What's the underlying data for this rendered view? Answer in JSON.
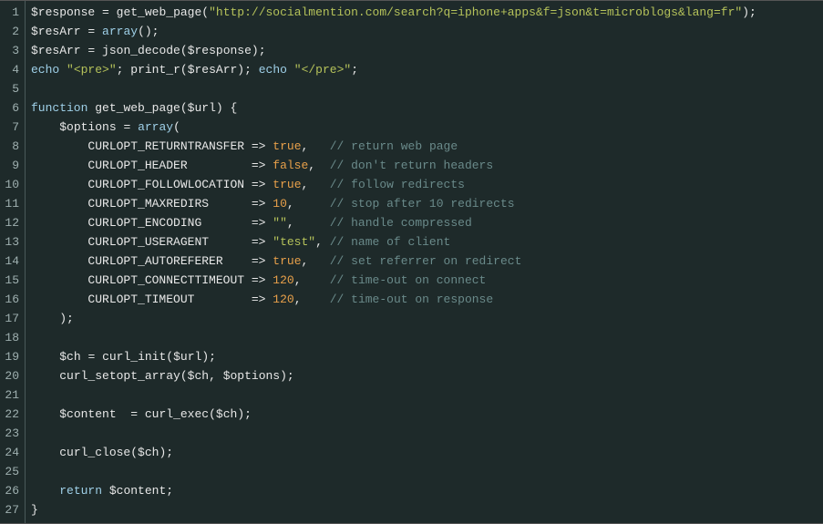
{
  "language": "php",
  "theme": "dark",
  "lines": [
    {
      "n": 1,
      "tokens": [
        {
          "t": "var",
          "v": "$response"
        },
        {
          "t": "plain",
          "v": " "
        },
        {
          "t": "op",
          "v": "="
        },
        {
          "t": "plain",
          "v": " "
        },
        {
          "t": "call",
          "v": "get_web_page"
        },
        {
          "t": "punc",
          "v": "("
        },
        {
          "t": "str",
          "v": "\"http://socialmention.com/search?q=iphone+apps&f=json&t=microblogs&lang=fr\""
        },
        {
          "t": "punc",
          "v": ")"
        },
        {
          "t": "punc",
          "v": ";"
        }
      ]
    },
    {
      "n": 2,
      "tokens": [
        {
          "t": "var",
          "v": "$resArr"
        },
        {
          "t": "plain",
          "v": " "
        },
        {
          "t": "op",
          "v": "="
        },
        {
          "t": "plain",
          "v": " "
        },
        {
          "t": "kw",
          "v": "array"
        },
        {
          "t": "punc",
          "v": "()"
        },
        {
          "t": "punc",
          "v": ";"
        }
      ]
    },
    {
      "n": 3,
      "tokens": [
        {
          "t": "var",
          "v": "$resArr"
        },
        {
          "t": "plain",
          "v": " "
        },
        {
          "t": "op",
          "v": "="
        },
        {
          "t": "plain",
          "v": " "
        },
        {
          "t": "call",
          "v": "json_decode"
        },
        {
          "t": "punc",
          "v": "("
        },
        {
          "t": "var",
          "v": "$response"
        },
        {
          "t": "punc",
          "v": ")"
        },
        {
          "t": "punc",
          "v": ";"
        }
      ]
    },
    {
      "n": 4,
      "tokens": [
        {
          "t": "kw",
          "v": "echo"
        },
        {
          "t": "plain",
          "v": " "
        },
        {
          "t": "str",
          "v": "\"<pre>\""
        },
        {
          "t": "punc",
          "v": ";"
        },
        {
          "t": "plain",
          "v": " "
        },
        {
          "t": "call",
          "v": "print_r"
        },
        {
          "t": "punc",
          "v": "("
        },
        {
          "t": "var",
          "v": "$resArr"
        },
        {
          "t": "punc",
          "v": ")"
        },
        {
          "t": "punc",
          "v": ";"
        },
        {
          "t": "plain",
          "v": " "
        },
        {
          "t": "kw",
          "v": "echo"
        },
        {
          "t": "plain",
          "v": " "
        },
        {
          "t": "str",
          "v": "\"</pre>\""
        },
        {
          "t": "punc",
          "v": ";"
        }
      ]
    },
    {
      "n": 5,
      "tokens": []
    },
    {
      "n": 6,
      "tokens": [
        {
          "t": "kw",
          "v": "function"
        },
        {
          "t": "plain",
          "v": " "
        },
        {
          "t": "fn",
          "v": "get_web_page"
        },
        {
          "t": "punc",
          "v": "("
        },
        {
          "t": "var",
          "v": "$url"
        },
        {
          "t": "punc",
          "v": ")"
        },
        {
          "t": "plain",
          "v": " "
        },
        {
          "t": "punc",
          "v": "{"
        }
      ]
    },
    {
      "n": 7,
      "tokens": [
        {
          "t": "plain",
          "v": "    "
        },
        {
          "t": "var",
          "v": "$options"
        },
        {
          "t": "plain",
          "v": " "
        },
        {
          "t": "op",
          "v": "="
        },
        {
          "t": "plain",
          "v": " "
        },
        {
          "t": "kw",
          "v": "array"
        },
        {
          "t": "punc",
          "v": "("
        }
      ]
    },
    {
      "n": 8,
      "tokens": [
        {
          "t": "plain",
          "v": "        "
        },
        {
          "t": "const",
          "v": "CURLOPT_RETURNTRANSFER"
        },
        {
          "t": "plain",
          "v": " "
        },
        {
          "t": "op",
          "v": "=>"
        },
        {
          "t": "plain",
          "v": " "
        },
        {
          "t": "bool",
          "v": "true"
        },
        {
          "t": "punc",
          "v": ","
        },
        {
          "t": "plain",
          "v": "   "
        },
        {
          "t": "cmt",
          "v": "// return web page"
        }
      ]
    },
    {
      "n": 9,
      "tokens": [
        {
          "t": "plain",
          "v": "        "
        },
        {
          "t": "const",
          "v": "CURLOPT_HEADER"
        },
        {
          "t": "plain",
          "v": "         "
        },
        {
          "t": "op",
          "v": "=>"
        },
        {
          "t": "plain",
          "v": " "
        },
        {
          "t": "bool",
          "v": "false"
        },
        {
          "t": "punc",
          "v": ","
        },
        {
          "t": "plain",
          "v": "  "
        },
        {
          "t": "cmt",
          "v": "// don't return headers"
        }
      ]
    },
    {
      "n": 10,
      "tokens": [
        {
          "t": "plain",
          "v": "        "
        },
        {
          "t": "const",
          "v": "CURLOPT_FOLLOWLOCATION"
        },
        {
          "t": "plain",
          "v": " "
        },
        {
          "t": "op",
          "v": "=>"
        },
        {
          "t": "plain",
          "v": " "
        },
        {
          "t": "bool",
          "v": "true"
        },
        {
          "t": "punc",
          "v": ","
        },
        {
          "t": "plain",
          "v": "   "
        },
        {
          "t": "cmt",
          "v": "// follow redirects"
        }
      ]
    },
    {
      "n": 11,
      "tokens": [
        {
          "t": "plain",
          "v": "        "
        },
        {
          "t": "const",
          "v": "CURLOPT_MAXREDIRS"
        },
        {
          "t": "plain",
          "v": "      "
        },
        {
          "t": "op",
          "v": "=>"
        },
        {
          "t": "plain",
          "v": " "
        },
        {
          "t": "num",
          "v": "10"
        },
        {
          "t": "punc",
          "v": ","
        },
        {
          "t": "plain",
          "v": "     "
        },
        {
          "t": "cmt",
          "v": "// stop after 10 redirects"
        }
      ]
    },
    {
      "n": 12,
      "tokens": [
        {
          "t": "plain",
          "v": "        "
        },
        {
          "t": "const",
          "v": "CURLOPT_ENCODING"
        },
        {
          "t": "plain",
          "v": "       "
        },
        {
          "t": "op",
          "v": "=>"
        },
        {
          "t": "plain",
          "v": " "
        },
        {
          "t": "str",
          "v": "\"\""
        },
        {
          "t": "punc",
          "v": ","
        },
        {
          "t": "plain",
          "v": "     "
        },
        {
          "t": "cmt",
          "v": "// handle compressed"
        }
      ]
    },
    {
      "n": 13,
      "tokens": [
        {
          "t": "plain",
          "v": "        "
        },
        {
          "t": "const",
          "v": "CURLOPT_USERAGENT"
        },
        {
          "t": "plain",
          "v": "      "
        },
        {
          "t": "op",
          "v": "=>"
        },
        {
          "t": "plain",
          "v": " "
        },
        {
          "t": "str",
          "v": "\"test\""
        },
        {
          "t": "punc",
          "v": ","
        },
        {
          "t": "plain",
          "v": " "
        },
        {
          "t": "cmt",
          "v": "// name of client"
        }
      ]
    },
    {
      "n": 14,
      "tokens": [
        {
          "t": "plain",
          "v": "        "
        },
        {
          "t": "const",
          "v": "CURLOPT_AUTOREFERER"
        },
        {
          "t": "plain",
          "v": "    "
        },
        {
          "t": "op",
          "v": "=>"
        },
        {
          "t": "plain",
          "v": " "
        },
        {
          "t": "bool",
          "v": "true"
        },
        {
          "t": "punc",
          "v": ","
        },
        {
          "t": "plain",
          "v": "   "
        },
        {
          "t": "cmt",
          "v": "// set referrer on redirect"
        }
      ]
    },
    {
      "n": 15,
      "tokens": [
        {
          "t": "plain",
          "v": "        "
        },
        {
          "t": "const",
          "v": "CURLOPT_CONNECTTIMEOUT"
        },
        {
          "t": "plain",
          "v": " "
        },
        {
          "t": "op",
          "v": "=>"
        },
        {
          "t": "plain",
          "v": " "
        },
        {
          "t": "num",
          "v": "120"
        },
        {
          "t": "punc",
          "v": ","
        },
        {
          "t": "plain",
          "v": "    "
        },
        {
          "t": "cmt",
          "v": "// time-out on connect"
        }
      ]
    },
    {
      "n": 16,
      "tokens": [
        {
          "t": "plain",
          "v": "        "
        },
        {
          "t": "const",
          "v": "CURLOPT_TIMEOUT"
        },
        {
          "t": "plain",
          "v": "        "
        },
        {
          "t": "op",
          "v": "=>"
        },
        {
          "t": "plain",
          "v": " "
        },
        {
          "t": "num",
          "v": "120"
        },
        {
          "t": "punc",
          "v": ","
        },
        {
          "t": "plain",
          "v": "    "
        },
        {
          "t": "cmt",
          "v": "// time-out on response"
        }
      ]
    },
    {
      "n": 17,
      "tokens": [
        {
          "t": "plain",
          "v": "    "
        },
        {
          "t": "punc",
          "v": ")"
        },
        {
          "t": "punc",
          "v": ";"
        }
      ]
    },
    {
      "n": 18,
      "tokens": []
    },
    {
      "n": 19,
      "tokens": [
        {
          "t": "plain",
          "v": "    "
        },
        {
          "t": "var",
          "v": "$ch"
        },
        {
          "t": "plain",
          "v": " "
        },
        {
          "t": "op",
          "v": "="
        },
        {
          "t": "plain",
          "v": " "
        },
        {
          "t": "call",
          "v": "curl_init"
        },
        {
          "t": "punc",
          "v": "("
        },
        {
          "t": "var",
          "v": "$url"
        },
        {
          "t": "punc",
          "v": ")"
        },
        {
          "t": "punc",
          "v": ";"
        }
      ]
    },
    {
      "n": 20,
      "tokens": [
        {
          "t": "plain",
          "v": "    "
        },
        {
          "t": "call",
          "v": "curl_setopt_array"
        },
        {
          "t": "punc",
          "v": "("
        },
        {
          "t": "var",
          "v": "$ch"
        },
        {
          "t": "punc",
          "v": ","
        },
        {
          "t": "plain",
          "v": " "
        },
        {
          "t": "var",
          "v": "$options"
        },
        {
          "t": "punc",
          "v": ")"
        },
        {
          "t": "punc",
          "v": ";"
        }
      ]
    },
    {
      "n": 21,
      "tokens": []
    },
    {
      "n": 22,
      "tokens": [
        {
          "t": "plain",
          "v": "    "
        },
        {
          "t": "var",
          "v": "$content"
        },
        {
          "t": "plain",
          "v": "  "
        },
        {
          "t": "op",
          "v": "="
        },
        {
          "t": "plain",
          "v": " "
        },
        {
          "t": "call",
          "v": "curl_exec"
        },
        {
          "t": "punc",
          "v": "("
        },
        {
          "t": "var",
          "v": "$ch"
        },
        {
          "t": "punc",
          "v": ")"
        },
        {
          "t": "punc",
          "v": ";"
        }
      ]
    },
    {
      "n": 23,
      "tokens": []
    },
    {
      "n": 24,
      "tokens": [
        {
          "t": "plain",
          "v": "    "
        },
        {
          "t": "call",
          "v": "curl_close"
        },
        {
          "t": "punc",
          "v": "("
        },
        {
          "t": "var",
          "v": "$ch"
        },
        {
          "t": "punc",
          "v": ")"
        },
        {
          "t": "punc",
          "v": ";"
        }
      ]
    },
    {
      "n": 25,
      "tokens": []
    },
    {
      "n": 26,
      "tokens": [
        {
          "t": "plain",
          "v": "    "
        },
        {
          "t": "kw",
          "v": "return"
        },
        {
          "t": "plain",
          "v": " "
        },
        {
          "t": "var",
          "v": "$content"
        },
        {
          "t": "punc",
          "v": ";"
        }
      ]
    },
    {
      "n": 27,
      "tokens": [
        {
          "t": "punc",
          "v": "}"
        }
      ]
    }
  ]
}
